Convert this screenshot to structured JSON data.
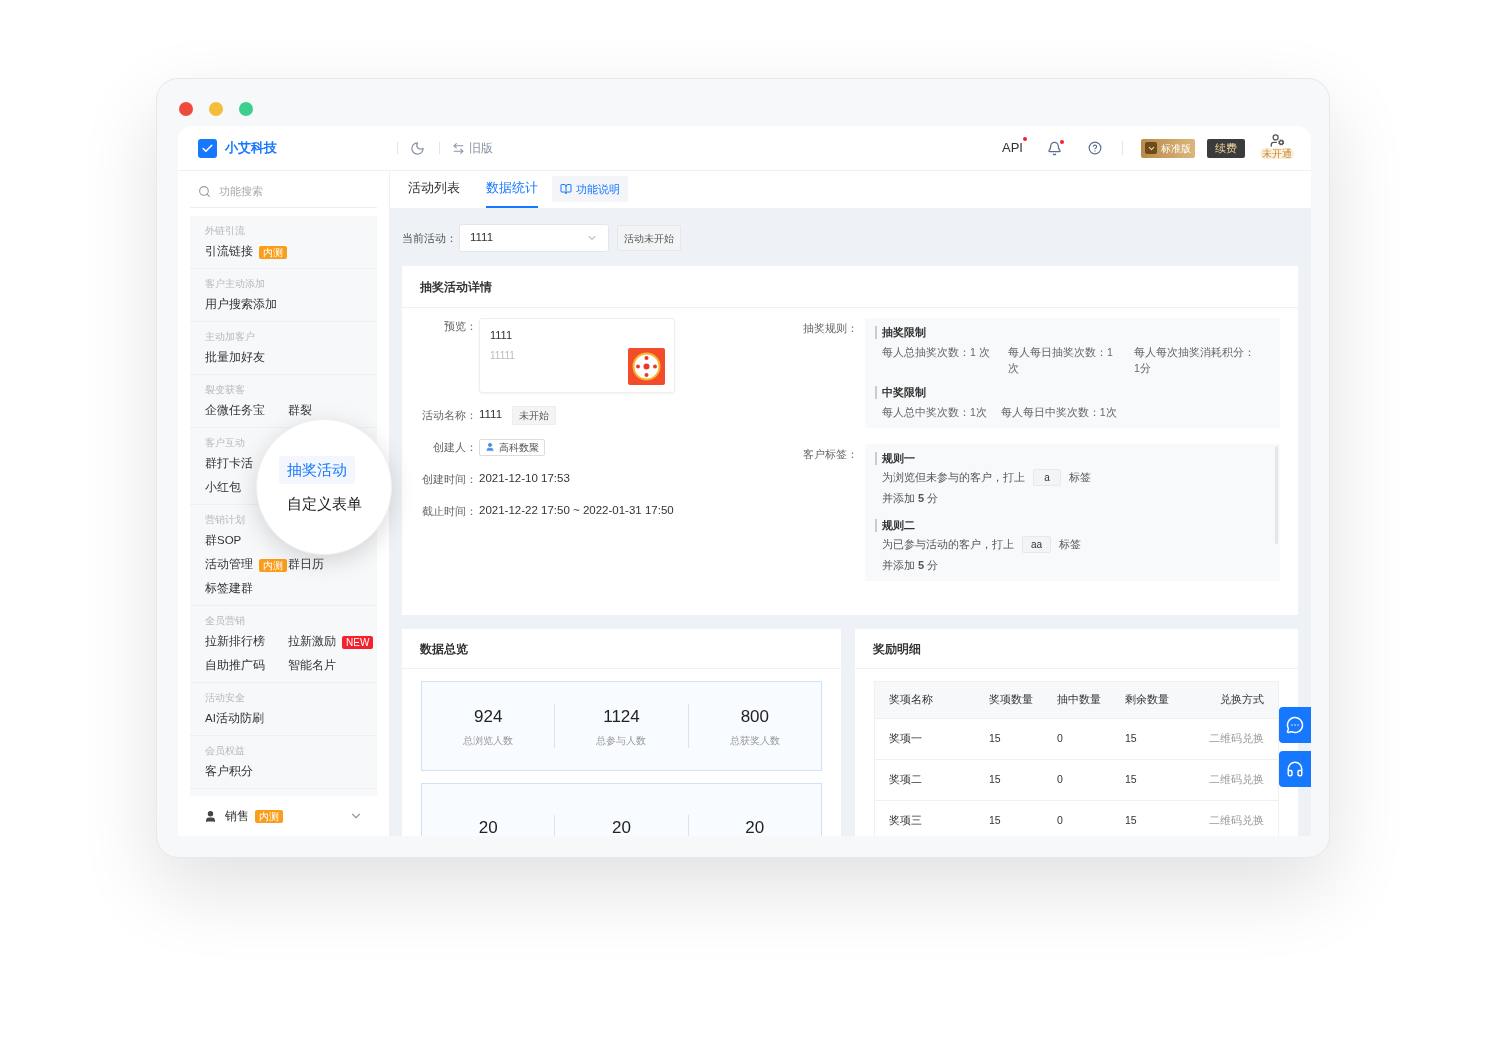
{
  "header": {
    "brand": "小艾科技",
    "old_version": "旧版",
    "api": {
      "label": "API",
      "dot": true
    },
    "notifications": {
      "dot": true
    },
    "plan": "标准版",
    "renew": "续费",
    "avatar_badge": "未开通"
  },
  "sidebar": {
    "search_placeholder": "功能搜索",
    "groups": [
      {
        "title": "外链引流",
        "rows": [
          [
            {
              "label": "引流链接",
              "badge": {
                "text": "内测",
                "kind": "beta"
              }
            }
          ]
        ]
      },
      {
        "title": "客户主动添加",
        "rows": [
          [
            {
              "label": "用户搜索添加"
            }
          ]
        ]
      },
      {
        "title": "主动加客户",
        "rows": [
          [
            {
              "label": "批量加好友"
            }
          ]
        ]
      },
      {
        "title": "裂变获客",
        "rows": [
          [
            {
              "label": "企微任务宝"
            },
            {
              "label": "群裂"
            }
          ]
        ]
      },
      {
        "title": "客户互动",
        "rows": [
          [
            {
              "label": "群打卡活"
            }
          ],
          [
            {
              "label": "小红包"
            }
          ]
        ]
      },
      {
        "title": "营销计划",
        "rows": [
          [
            {
              "label": "群SOP"
            }
          ],
          [
            {
              "label": "活动管理",
              "badge": {
                "text": "内测",
                "kind": "beta"
              }
            },
            {
              "label": "群日历"
            }
          ],
          [
            {
              "label": "标签建群"
            }
          ]
        ]
      },
      {
        "title": "全员营销",
        "rows": [
          [
            {
              "label": "拉新排行榜"
            },
            {
              "label": "拉新激励",
              "badge": {
                "text": "NEW",
                "kind": "new"
              }
            }
          ],
          [
            {
              "label": "自助推广码"
            },
            {
              "label": "智能名片"
            }
          ]
        ]
      },
      {
        "title": "活动安全",
        "rows": [
          [
            {
              "label": "AI活动防刷"
            }
          ]
        ]
      },
      {
        "title": "会员权益",
        "rows": [
          [
            {
              "label": "客户积分"
            }
          ]
        ]
      }
    ],
    "footer": {
      "label": "销售",
      "badge": {
        "text": "内测",
        "kind": "beta"
      },
      "expanded": false
    }
  },
  "popover": {
    "items": [
      {
        "label": "抽奖活动",
        "selected": true
      },
      {
        "label": "自定义表单",
        "selected": false
      }
    ]
  },
  "tabs": [
    {
      "label": "活动列表",
      "selected": false
    },
    {
      "label": "数据统计",
      "selected": true
    }
  ],
  "help_button": "功能说明",
  "activity_select": {
    "label": "当前活动：",
    "value": "1111",
    "status": "活动未开始"
  },
  "detail": {
    "title": "抽奖活动详情",
    "preview_label": "预览：",
    "preview": {
      "title": "1111",
      "subtitle": "11111"
    },
    "fields": [
      {
        "kind": "status",
        "label": "活动名称：",
        "value": "1111",
        "tag": "未开始"
      },
      {
        "kind": "user",
        "label": "创建人：",
        "value": "高科数聚"
      },
      {
        "kind": "text",
        "label": "创建时间：",
        "value": "2021-12-10 17:53"
      },
      {
        "kind": "text",
        "label": "截止时间：",
        "value": "2021-12-22 17:50 ~ 2022-01-31 17:50"
      }
    ],
    "rules_label": "抽奖规则：",
    "rule_sections": [
      {
        "title": "抽奖限制",
        "items": [
          "每人总抽奖次数：1 次",
          "每人每日抽奖次数：1 次",
          "每人每次抽奖消耗积分：1分"
        ]
      },
      {
        "title": "中奖限制",
        "items": [
          "每人总中奖次数：1次",
          "每人每日中奖次数：1次"
        ]
      }
    ],
    "tags_label": "客户标签：",
    "tag_rules": [
      {
        "title": "规则一",
        "before": "为浏览但未参与的客户，打上",
        "tag": "a",
        "after": "标签",
        "points": "并添加 **5** 分"
      },
      {
        "title": "规则二",
        "before": "为已参与活动的客户，打上",
        "tag": "aa",
        "after": "标签",
        "points": "并添加 **5** 分"
      }
    ]
  },
  "overview": {
    "title": "数据总览",
    "rows": [
      [
        {
          "value": "924",
          "label": "总浏览人数"
        },
        {
          "value": "1124",
          "label": "总参与人数"
        },
        {
          "value": "800",
          "label": "总获奖人数"
        }
      ],
      [
        {
          "value": "20"
        },
        {
          "value": "20"
        },
        {
          "value": "20"
        }
      ]
    ]
  },
  "prizes": {
    "title": "奖励明细",
    "columns": [
      "奖项名称",
      "奖项数量",
      "抽中数量",
      "剩余数量",
      "兑换方式"
    ],
    "rows": [
      [
        "奖项一",
        "15",
        "0",
        "15",
        "二维码兑换"
      ],
      [
        "奖项二",
        "15",
        "0",
        "15",
        "二维码兑换"
      ],
      [
        "奖项三",
        "15",
        "0",
        "15",
        "二维码兑换"
      ]
    ]
  }
}
